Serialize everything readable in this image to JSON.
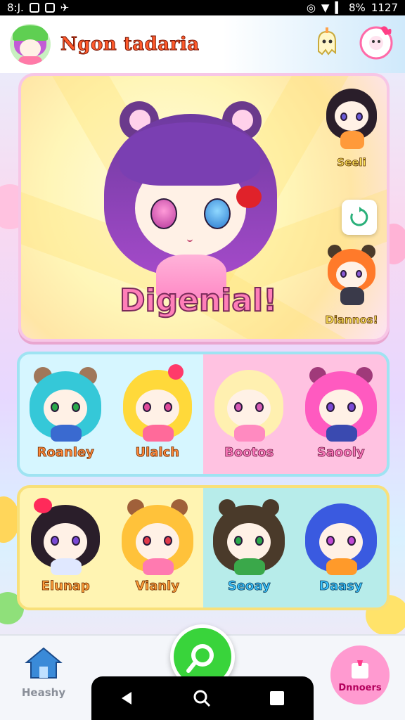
{
  "status_bar": {
    "left_text": "8:J.",
    "right_text": "1127",
    "battery": "8%"
  },
  "header": {
    "title": "Ngon tadaria"
  },
  "hero": {
    "name": "Digenial!",
    "side_characters": [
      {
        "label": "Seeli"
      },
      {
        "label": "Diannos!"
      }
    ]
  },
  "grid_row_1": [
    {
      "label": "Roanley"
    },
    {
      "label": "Ulalch"
    },
    {
      "label": "Bootos"
    },
    {
      "label": "Saooly"
    }
  ],
  "grid_row_2": [
    {
      "label": "Elunap"
    },
    {
      "label": "Vianly"
    },
    {
      "label": "Seoay"
    },
    {
      "label": "Daasy"
    }
  ],
  "bottom_nav": {
    "home_label": "Heashy",
    "dancers_label": "Dnnoers"
  },
  "colors": {
    "accent_title": "#ff5a2b",
    "search_button": "#39d43b",
    "dancers_button": "#ff9ad0",
    "hero_name": "#ff7fb8"
  },
  "icons": {
    "home": "house-icon",
    "search": "magnifier-icon",
    "dancers": "dancers-icon",
    "refresh": "refresh-icon",
    "header_ghost": "ghost-icon",
    "header_flower": "flower-icon"
  }
}
